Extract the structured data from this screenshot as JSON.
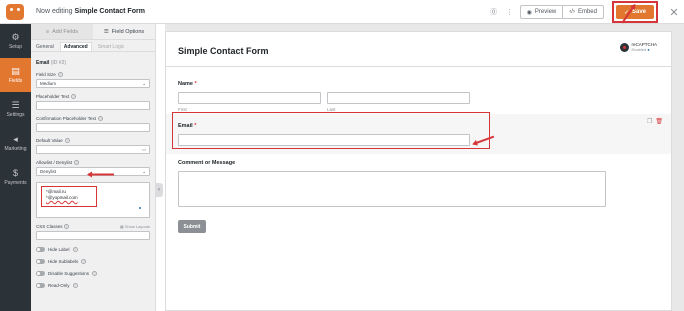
{
  "app": {
    "title_prefix": "Now editing",
    "form_name": "Simple Contact Form"
  },
  "topbar": {
    "preview_label": "Preview",
    "embed_label": "Embed",
    "save_label": "Save",
    "preview_icon": "eye-icon",
    "embed_icon": "code-icon",
    "save_icon": "check-icon",
    "close_icon": "close-icon",
    "help_icon": "help-icon",
    "accent_color": "#e27730"
  },
  "sidebar": {
    "items": [
      {
        "label": "Setup",
        "icon": "gear-icon"
      },
      {
        "label": "Fields",
        "icon": "fields-icon"
      },
      {
        "label": "Settings",
        "icon": "sliders-icon"
      },
      {
        "label": "Marketing",
        "icon": "megaphone-icon"
      },
      {
        "label": "Payments",
        "icon": "dollar-icon"
      }
    ],
    "active_index": 1
  },
  "panel": {
    "tabs": [
      {
        "label": "Add Fields",
        "icon": "list-icon"
      },
      {
        "label": "Field Options",
        "icon": "sliders-icon"
      }
    ],
    "sub_tabs": [
      "General",
      "Advanced",
      "Smart Logic"
    ],
    "field_name": "Email",
    "field_id": "(ID #2)",
    "field_size_label": "Field Size",
    "field_size_value": "Medium",
    "placeholder_label": "Placeholder Text",
    "confirm_placeholder_label": "Confirmation Placeholder Text",
    "default_value_label": "Default Value",
    "allowlist_label": "Allowlist / Denylist",
    "allowlist_value": "Denylist",
    "denylist_entries": [
      "*@mail.ru",
      "*@yopmail.com"
    ],
    "css_classes_label": "CSS Classes",
    "show_layouts_label": "Show Layouts",
    "toggles": [
      "Hide Label",
      "Hide Sublabels",
      "Disable Suggestions",
      "Read-Only"
    ]
  },
  "form": {
    "title": "Simple Contact Form",
    "recaptcha_label": "reCAPTCHA",
    "recaptcha_status": "Enabled",
    "name_label": "Name",
    "first_label": "First",
    "last_label": "Last",
    "email_label": "Email",
    "comment_label": "Comment or Message",
    "submit_label": "Submit",
    "required_mark": "*"
  }
}
